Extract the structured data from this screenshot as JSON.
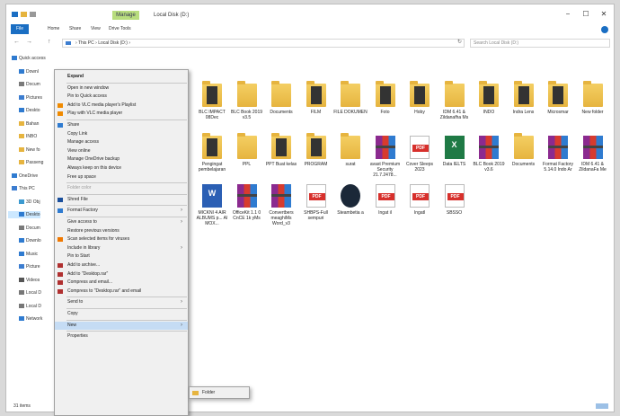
{
  "window": {
    "title": "Local Disk (D:)",
    "manage_tab": "Manage",
    "controls": {
      "minimize": "−",
      "maximize": "☐",
      "close": "✕"
    }
  },
  "ribbon": {
    "tabs": [
      "File",
      "Home",
      "Share",
      "View",
      "Drive Tools"
    ]
  },
  "address": {
    "back": "←",
    "forward": "→",
    "up": "↑",
    "path": "› This PC › Local Disk (D:) ›",
    "refresh": "↻",
    "search_placeholder": "Search Local Disk (D:)"
  },
  "nav_pane": [
    {
      "label": "Quick access",
      "icon": "star-icon",
      "color": "#2f7bd0"
    },
    {
      "label": "Downl",
      "icon": "download-icon",
      "color": "#2f7bd0"
    },
    {
      "label": "Docum",
      "icon": "document-icon",
      "color": "#7a7a7a"
    },
    {
      "label": "Pictures",
      "icon": "pictures-icon",
      "color": "#3c7dd0"
    },
    {
      "label": "Deskto",
      "icon": "desktop-icon",
      "color": "#2f7bd0"
    },
    {
      "label": "Bahan",
      "icon": "folder-icon",
      "color": "#e6b43f"
    },
    {
      "label": "INBO",
      "icon": "folder-icon",
      "color": "#e6b43f"
    },
    {
      "label": "New fo",
      "icon": "folder-icon",
      "color": "#e6b43f"
    },
    {
      "label": "Passeng",
      "icon": "folder-icon",
      "color": "#e6b43f"
    },
    {
      "label": "OneDrive",
      "icon": "cloud-icon",
      "color": "#2f7bd0"
    },
    {
      "label": "This PC",
      "icon": "pc-icon",
      "color": "#3c7dd0"
    },
    {
      "label": "3D Obj",
      "icon": "cube-icon",
      "color": "#3c9ad0"
    },
    {
      "label": "Deskto",
      "icon": "desktop-icon",
      "color": "#2f7bd0"
    },
    {
      "label": "Docum",
      "icon": "document-icon",
      "color": "#7a7a7a"
    },
    {
      "label": "Downlo",
      "icon": "download-icon",
      "color": "#2f7bd0"
    },
    {
      "label": "Music",
      "icon": "music-icon",
      "color": "#2f7bd0"
    },
    {
      "label": "Picture",
      "icon": "pictures-icon",
      "color": "#3c7dd0"
    },
    {
      "label": "Videos",
      "icon": "video-icon",
      "color": "#555555"
    },
    {
      "label": "Local D",
      "icon": "drive-icon",
      "color": "#777777"
    },
    {
      "label": "Local D",
      "icon": "drive-icon",
      "color": "#777777"
    },
    {
      "label": "Network",
      "icon": "network-icon",
      "color": "#2f7bd0"
    }
  ],
  "files": [
    {
      "label": "BLC IMPACT 08Dec",
      "type": "cover"
    },
    {
      "label": "BLC Book 2019 v3.5",
      "type": "folder"
    },
    {
      "label": "Documents",
      "type": "folder"
    },
    {
      "label": "FILM",
      "type": "cover"
    },
    {
      "label": "FILE DOKUMEN",
      "type": "folder"
    },
    {
      "label": "Foto",
      "type": "cover"
    },
    {
      "label": "Hoby",
      "type": "cover"
    },
    {
      "label": "IDM 6.41 & Zildanafha Ms",
      "type": "folder"
    },
    {
      "label": "INDO",
      "type": "cover"
    },
    {
      "label": "Indra Lens",
      "type": "cover"
    },
    {
      "label": "Microsmar",
      "type": "cover"
    },
    {
      "label": "New folder",
      "type": "folder"
    },
    {
      "label": "Pengingat pembelajaran",
      "type": "cover"
    },
    {
      "label": "PPL",
      "type": "folder"
    },
    {
      "label": "PPT Buat kelas",
      "type": "cover"
    },
    {
      "label": "PROGRAM",
      "type": "cover"
    },
    {
      "label": "surat",
      "type": "folder"
    },
    {
      "label": "avast Premium Security 21.7.2478...",
      "type": "rar"
    },
    {
      "label": "Cover Sleeps 2023",
      "type": "pdf"
    },
    {
      "label": "Data IELTS",
      "type": "xls"
    },
    {
      "label": "BLC Book 2019 v3.6",
      "type": "rar"
    },
    {
      "label": "Documents",
      "type": "folder"
    },
    {
      "label": "Format Factory 5.14.0 Indo Ar",
      "type": "rar"
    },
    {
      "label": "IDM 6.41 & ZildanaFa Me",
      "type": "rar"
    },
    {
      "label": "MICKNI 4 AIR ALBUMS p... AI MOX...",
      "type": "doc"
    },
    {
      "label": "OfficeKit 1.1 0 CnCE 1k yMs",
      "type": "rar"
    },
    {
      "label": "Convertbers meaghiMs Word_v3",
      "type": "rar"
    },
    {
      "label": "SHBPS-Full sempuri",
      "type": "pdf"
    },
    {
      "label": "Steambetia a",
      "type": "steam"
    },
    {
      "label": "Ingat il",
      "type": "pdf"
    },
    {
      "label": "Ingatl",
      "type": "pdf"
    },
    {
      "label": "SBSSO",
      "type": "pdf"
    }
  ],
  "context_menu": [
    {
      "label": "Expand",
      "bold": true
    },
    {
      "sep": true
    },
    {
      "label": "Open in new window"
    },
    {
      "label": "Pin to Quick access"
    },
    {
      "label": "Add to VLC media player's Playlist",
      "icon": "vlc-icon",
      "color": "#f08a00"
    },
    {
      "label": "Play with VLC media player",
      "icon": "vlc-icon",
      "color": "#f08a00"
    },
    {
      "sep": true
    },
    {
      "label": "Share",
      "icon": "cloud-icon",
      "color": "#2f7bd0"
    },
    {
      "label": "Copy Link"
    },
    {
      "label": "Manage access"
    },
    {
      "label": "View online"
    },
    {
      "label": "Manage OneDrive backup"
    },
    {
      "label": "Always keep on this device"
    },
    {
      "label": "Free up space"
    },
    {
      "sep": true
    },
    {
      "label": "Folder color",
      "disabled": true
    },
    {
      "sep": true
    },
    {
      "label": "Shred File",
      "icon": "shred-icon",
      "color": "#1a4f9c"
    },
    {
      "sep": true
    },
    {
      "label": "Format Factory",
      "icon": "format-factory-icon",
      "color": "#2f7bd0",
      "arrow": true
    },
    {
      "sep": true
    },
    {
      "label": "Give access to",
      "arrow": true
    },
    {
      "label": "Restore previous versions"
    },
    {
      "label": "Scan selected items for viruses",
      "icon": "avast-icon",
      "color": "#f07800"
    },
    {
      "label": "Include in library",
      "arrow": true
    },
    {
      "label": "Pin to Start"
    },
    {
      "label": "Add to archive...",
      "icon": "winrar-icon",
      "color": "#b03030"
    },
    {
      "label": "Add to \"Desktop.rar\"",
      "icon": "winrar-icon",
      "color": "#b03030"
    },
    {
      "label": "Compress and email...",
      "icon": "winrar-icon",
      "color": "#b03030"
    },
    {
      "label": "Compress to \"Desktop.rar\" and email",
      "icon": "winrar-icon",
      "color": "#b03030"
    },
    {
      "sep": true
    },
    {
      "label": "Send to",
      "arrow": true
    },
    {
      "sep": true
    },
    {
      "label": "Copy"
    },
    {
      "sep": true
    },
    {
      "label": "New",
      "arrow": true,
      "highlight": true
    },
    {
      "sep": true
    },
    {
      "label": "Properties"
    }
  ],
  "submenu": {
    "label": "Folder",
    "icon": "folder-icon"
  },
  "status": {
    "items": "31 items"
  }
}
